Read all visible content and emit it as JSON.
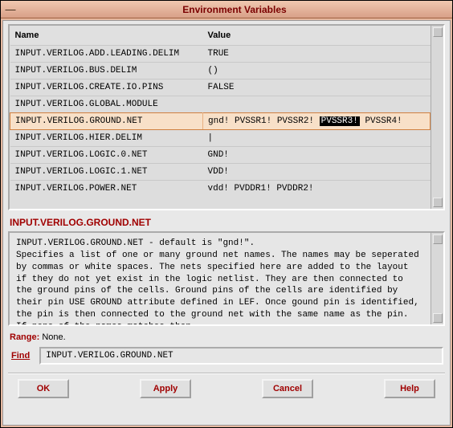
{
  "window": {
    "title": "Environment Variables"
  },
  "table": {
    "columns": {
      "name": "Name",
      "value": "Value"
    },
    "selected_name": "INPUT.VERILOG.GROUND.NET",
    "highlight_token": "PVSSR3!",
    "rows": [
      {
        "name": "INPUT.VERILOG.ADD.LEADING.DELIM",
        "value": "TRUE"
      },
      {
        "name": "INPUT.VERILOG.BUS.DELIM",
        "value": "()"
      },
      {
        "name": "INPUT.VERILOG.CREATE.IO.PINS",
        "value": "FALSE"
      },
      {
        "name": "INPUT.VERILOG.GLOBAL.MODULE",
        "value": ""
      },
      {
        "name": "INPUT.VERILOG.GROUND.NET",
        "value": "gnd! PVSSR1! PVSSR2! PVSSR3! PVSSR4!"
      },
      {
        "name": "INPUT.VERILOG.HIER.DELIM",
        "value": "|"
      },
      {
        "name": "INPUT.VERILOG.LOGIC.0.NET",
        "value": "GND!"
      },
      {
        "name": "INPUT.VERILOG.LOGIC.1.NET",
        "value": "VDD!"
      },
      {
        "name": "INPUT.VERILOG.POWER.NET",
        "value": "vdd! PVDDR1! PVDDR2!"
      }
    ]
  },
  "detail": {
    "heading": "INPUT.VERILOG.GROUND.NET",
    "description": "INPUT.VERILOG.GROUND.NET - default is \"gnd!\".\nSpecifies a list of one or many ground net names. The names may be seperated by commas or white spaces. The nets specified here are added to the layout if they do not yet exist in the logic netlist. They are then connected to the ground pins of the cells. Ground pins of the cells are identified by their pin USE GROUND attribute defined in LEF. Once gound pin is identified, the pin is then connected to the ground net with the same name as the pin. If none of the names matches then",
    "range_label": "Range:",
    "range_value": "None."
  },
  "find": {
    "button_label": "Find",
    "value": "INPUT.VERILOG.GROUND.NET"
  },
  "buttons": {
    "ok": "OK",
    "apply": "Apply",
    "cancel": "Cancel",
    "help": "Help"
  }
}
